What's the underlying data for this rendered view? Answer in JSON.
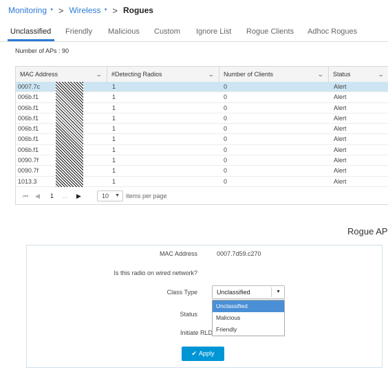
{
  "breadcrumb": {
    "items": [
      {
        "label": "Monitoring",
        "caret": "▾"
      },
      {
        "label": "Wireless",
        "caret": "▾"
      }
    ],
    "separator": ">",
    "current": "Rogues"
  },
  "tabs": [
    {
      "label": "Unclassified",
      "active": true
    },
    {
      "label": "Friendly"
    },
    {
      "label": "Malicious"
    },
    {
      "label": "Custom"
    },
    {
      "label": "Ignore List"
    },
    {
      "label": "Rogue Clients"
    },
    {
      "label": "Adhoc Rogues"
    }
  ],
  "summary": {
    "label": "Number of APs : 90"
  },
  "table": {
    "columns": [
      "MAC Address",
      "#Detecting Radios",
      "Number of Clients",
      "Status"
    ],
    "rows": [
      {
        "mac": "0007.7c",
        "radios": "1",
        "clients": "0",
        "status": "Alert",
        "selected": true
      },
      {
        "mac": "006b.f1",
        "radios": "1",
        "clients": "0",
        "status": "Alert"
      },
      {
        "mac": "006b.f1",
        "radios": "1",
        "clients": "0",
        "status": "Alert"
      },
      {
        "mac": "006b.f1",
        "radios": "1",
        "clients": "0",
        "status": "Alert"
      },
      {
        "mac": "006b.f1",
        "radios": "1",
        "clients": "0",
        "status": "Alert"
      },
      {
        "mac": "006b.f1",
        "radios": "1",
        "clients": "0",
        "status": "Alert"
      },
      {
        "mac": "006b.f1",
        "radios": "1",
        "clients": "0",
        "status": "Alert"
      },
      {
        "mac": "0090.7f",
        "radios": "1",
        "clients": "0",
        "status": "Alert"
      },
      {
        "mac": "0090.7f",
        "radios": "1",
        "clients": "0",
        "status": "Alert"
      },
      {
        "mac": "1013.3",
        "radios": "1",
        "clients": "0",
        "status": "Alert"
      }
    ]
  },
  "pager": {
    "first": "⏮",
    "prev": "◀",
    "page": "1",
    "ellipsis": "...",
    "next": "▶",
    "per_page_value": "10",
    "per_page_label": "items per page"
  },
  "detail": {
    "title": "Rogue AP I",
    "mac_label": "MAC Address",
    "mac_value": "0007.7d59.c270",
    "wired_label": "Is this radio on wired network?",
    "class_type_label": "Class Type",
    "class_type_value": "Unclassified",
    "class_options": [
      "Unclassified",
      "Malicious",
      "Friendly"
    ],
    "status_label": "Status",
    "rldp_label": "Initiate RLDP",
    "apply_label": "Apply"
  },
  "colors": {
    "accent": "#2a7bd6",
    "selected_row": "#cde5f3",
    "apply_button": "#0096d6",
    "highlight_option": "#4a8fd6"
  }
}
